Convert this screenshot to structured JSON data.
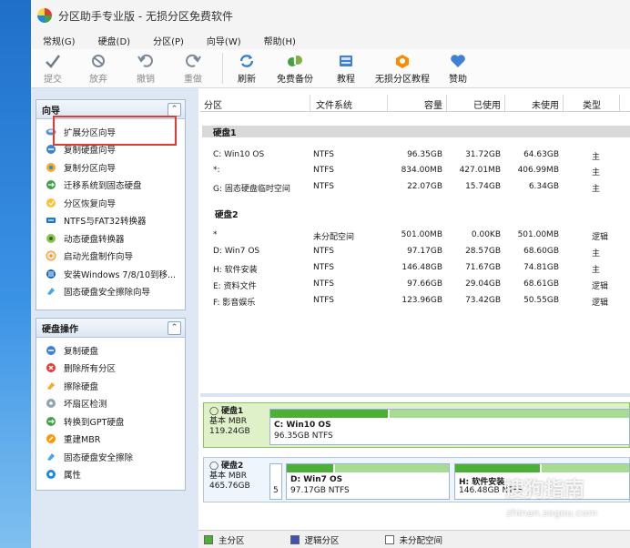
{
  "window": {
    "title": "分区助手专业版 - 无损分区免费软件"
  },
  "menu": [
    "常规(G)",
    "硬盘(D)",
    "分区(P)",
    "向导(W)",
    "帮助(H)"
  ],
  "toolbar": {
    "submit": "提交",
    "discard": "放弃",
    "undo": "撤销",
    "redo": "重做",
    "refresh": "刷新",
    "backup": "免费备份",
    "tutorial": "教程",
    "guide": "无损分区教程",
    "sponsor": "赞助"
  },
  "wizard_panel": {
    "title": "向导",
    "items": [
      "扩展分区向导",
      "复制硬盘向导",
      "复制分区向导",
      "迁移系统到固态硬盘",
      "分区恢复向导",
      "NTFS与FAT32转换器",
      "动态硬盘转换器",
      "启动光盘制作向导",
      "安装Windows 7/8/10到移...",
      "固态硬盘安全擦除向导"
    ]
  },
  "disk_ops_panel": {
    "title": "硬盘操作",
    "items": [
      "复制硬盘",
      "删除所有分区",
      "擦除硬盘",
      "坏扇区检测",
      "转换到GPT硬盘",
      "重建MBR",
      "固态硬盘安全擦除",
      "属性"
    ]
  },
  "columns": {
    "partition": "分区",
    "fs": "文件系统",
    "capacity": "容量",
    "used": "已使用",
    "free": "未使用",
    "type": "类型"
  },
  "disks": [
    {
      "label": "硬盘1",
      "rows": [
        {
          "name": "C: Win10 OS",
          "fs": "NTFS",
          "capacity": "96.35GB",
          "used": "31.72GB",
          "free": "64.63GB",
          "type": "主"
        },
        {
          "name": "*:",
          "fs": "NTFS",
          "capacity": "834.00MB",
          "used": "427.01MB",
          "free": "406.99MB",
          "type": "主"
        },
        {
          "name": "G: 固态硬盘临时空间",
          "fs": "NTFS",
          "capacity": "22.07GB",
          "used": "15.74GB",
          "free": "6.34GB",
          "type": "主"
        }
      ]
    },
    {
      "label": "硬盘2",
      "rows": [
        {
          "name": "*",
          "fs": "未分配空间",
          "capacity": "501.00MB",
          "used": "0.00KB",
          "free": "501.00MB",
          "type": "逻辑"
        },
        {
          "name": "D: Win7 OS",
          "fs": "NTFS",
          "capacity": "97.17GB",
          "used": "28.57GB",
          "free": "68.60GB",
          "type": "主"
        },
        {
          "name": "H: 软件安装",
          "fs": "NTFS",
          "capacity": "146.48GB",
          "used": "71.67GB",
          "free": "74.81GB",
          "type": "主"
        },
        {
          "name": "E: 资料文件",
          "fs": "NTFS",
          "capacity": "97.66GB",
          "used": "29.04GB",
          "free": "68.61GB",
          "type": "逻辑"
        },
        {
          "name": "F: 影音娱乐",
          "fs": "NTFS",
          "capacity": "123.96GB",
          "used": "73.42GB",
          "free": "50.55GB",
          "type": "逻辑"
        }
      ]
    }
  ],
  "disk_map": {
    "disk1": {
      "name": "硬盘1",
      "kind": "基本 MBR",
      "size": "119.24GB",
      "vol_title": "C: Win10 OS",
      "vol_size": "96.35GB NTFS",
      "used_fraction": 0.33
    },
    "disk2": {
      "name": "硬盘2",
      "kind": "基本 MBR",
      "size": "465.76GB",
      "small_label": "5",
      "vol1_title": "D: Win7 OS",
      "vol1_size": "97.17GB NTFS",
      "vol1_used_fraction": 0.29,
      "vol2_title": "H: 软件安装",
      "vol2_size": "146.48GB NTFS",
      "vol2_used_fraction": 0.49
    }
  },
  "legend": {
    "primary": "主分区",
    "logical": "逻辑分区",
    "unallocated": "未分配空间"
  },
  "watermark": {
    "text": "搜狗指南",
    "sub": "zhinan.sogou.com"
  },
  "colors": {
    "primary": "#4caf36",
    "logical": "#3f51b5",
    "unallocated": "#ffffff",
    "highlight": "#e53935"
  }
}
